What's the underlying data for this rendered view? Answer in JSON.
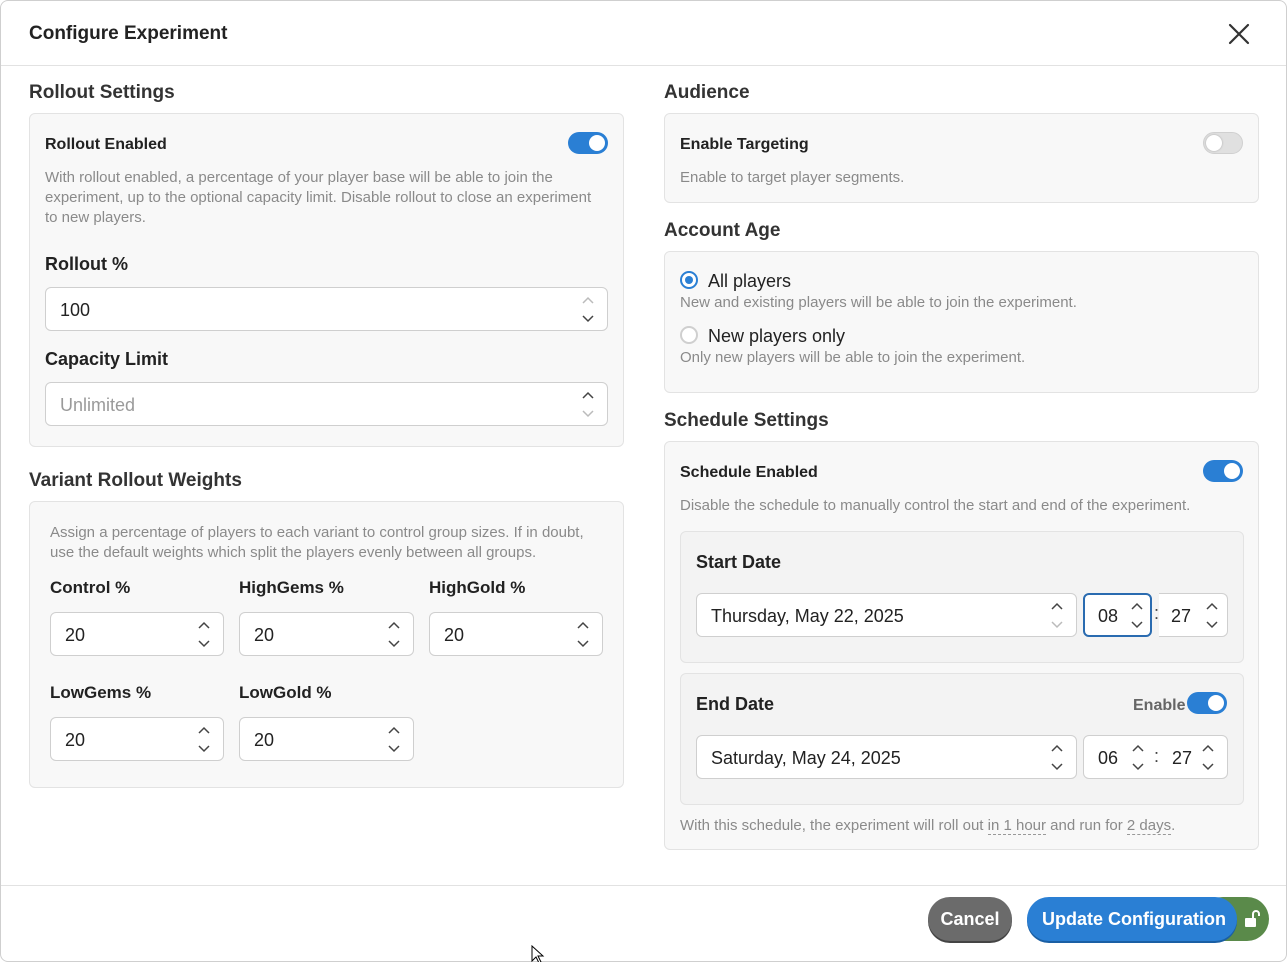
{
  "header": {
    "title": "Configure Experiment"
  },
  "rollout": {
    "section_title": "Rollout Settings",
    "enabled_label": "Rollout Enabled",
    "enabled": true,
    "help": "With rollout enabled, a percentage of your player base will be able to join the experiment, up to the optional capacity limit. Disable rollout to close an experiment to new players.",
    "percent_label": "Rollout %",
    "percent_value": "100",
    "capacity_label": "Capacity Limit",
    "capacity_placeholder": "Unlimited"
  },
  "variants": {
    "section_title": "Variant Rollout Weights",
    "help": "Assign a percentage of players to each variant to control group sizes. If in doubt, use the default weights which split the players evenly between all groups.",
    "items": [
      {
        "label": "Control %",
        "value": "20"
      },
      {
        "label": "HighGems %",
        "value": "20"
      },
      {
        "label": "HighGold %",
        "value": "20"
      },
      {
        "label": "LowGems %",
        "value": "20"
      },
      {
        "label": "LowGold %",
        "value": "20"
      }
    ]
  },
  "audience": {
    "section_title": "Audience",
    "targeting_label": "Enable Targeting",
    "targeting_enabled": false,
    "help": "Enable to target player segments."
  },
  "account_age": {
    "section_title": "Account Age",
    "options": [
      {
        "label": "All players",
        "help": "New and existing players will be able to join the experiment.",
        "selected": true
      },
      {
        "label": "New players only",
        "help": "Only new players will be able to join the experiment.",
        "selected": false
      }
    ]
  },
  "schedule": {
    "section_title": "Schedule Settings",
    "enabled_label": "Schedule Enabled",
    "enabled": true,
    "help": "Disable the schedule to manually control the start and end of the experiment.",
    "start": {
      "label": "Start Date",
      "date": "Thursday, May 22, 2025",
      "hour": "08",
      "minute": "27"
    },
    "end": {
      "label": "End Date",
      "enable_label": "Enable",
      "enabled": true,
      "date": "Saturday, May 24, 2025",
      "hour": "06",
      "minute": "27"
    },
    "summary_prefix": "With this schedule, the experiment will roll out ",
    "summary_start": "in 1 hour",
    "summary_mid": " and run for ",
    "summary_duration": "2 days",
    "summary_suffix": "."
  },
  "footer": {
    "cancel_label": "Cancel",
    "update_label": "Update Configuration"
  },
  "colors": {
    "accent": "#2a7fd4",
    "cancel": "#6b6b6b",
    "lock": "#5a8a4a"
  }
}
